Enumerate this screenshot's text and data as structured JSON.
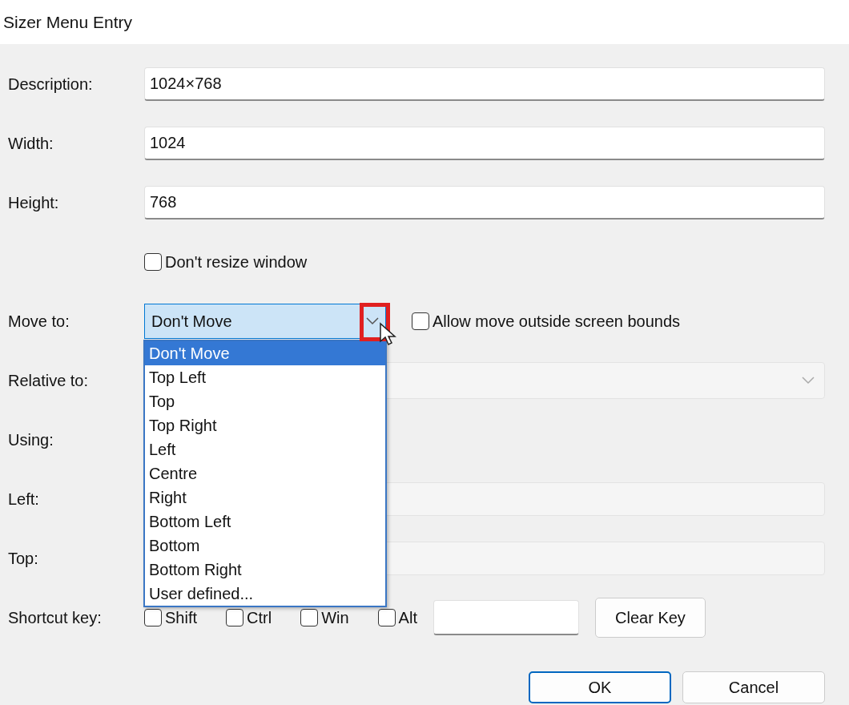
{
  "window": {
    "title": "Sizer Menu Entry"
  },
  "rows": [
    {
      "kind": "text",
      "label": "Description:",
      "value": "1024×768",
      "disabled": false
    },
    {
      "kind": "text",
      "label": "Width:",
      "value": "1024",
      "disabled": false
    },
    {
      "kind": "text",
      "label": "Height:",
      "value": "768",
      "disabled": false
    },
    {
      "kind": "checkbox",
      "label": "Don't resize window",
      "checked": false
    },
    {
      "kind": "select",
      "label": "Move to:",
      "value": "Don't Move",
      "expanded": true,
      "highlighted": true,
      "options": [
        {
          "label": "Don't Move",
          "selected": true
        },
        {
          "label": "Top Left",
          "selected": false
        },
        {
          "label": "Top",
          "selected": false
        },
        {
          "label": "Top Right",
          "selected": false
        },
        {
          "label": "Left",
          "selected": false
        },
        {
          "label": "Centre",
          "selected": false
        },
        {
          "label": "Right",
          "selected": false
        },
        {
          "label": "Bottom Left",
          "selected": false
        },
        {
          "label": "Bottom",
          "selected": false
        },
        {
          "label": "Bottom Right",
          "selected": false
        },
        {
          "label": "User defined...",
          "selected": false
        }
      ],
      "extra": {
        "label": "Allow move outside screen bounds",
        "checked": false
      }
    },
    {
      "kind": "wideselect",
      "label": "Relative to:",
      "disabled": true
    },
    {
      "kind": "label",
      "label": "Using:"
    },
    {
      "kind": "text",
      "label": "Left:",
      "value": "",
      "disabled": true
    },
    {
      "kind": "text",
      "label": "Top:",
      "value": "",
      "disabled": true
    },
    {
      "kind": "shortcut",
      "label": "Shortcut key:",
      "modifiers": [
        {
          "label": "Shift",
          "checked": false
        },
        {
          "label": "Ctrl",
          "checked": false
        },
        {
          "label": "Win",
          "checked": false
        },
        {
          "label": "Alt",
          "checked": false
        }
      ],
      "clear_button": "Clear Key"
    }
  ],
  "buttons": [
    {
      "label": "OK",
      "default": true
    },
    {
      "label": "Cancel",
      "default": false
    }
  ]
}
